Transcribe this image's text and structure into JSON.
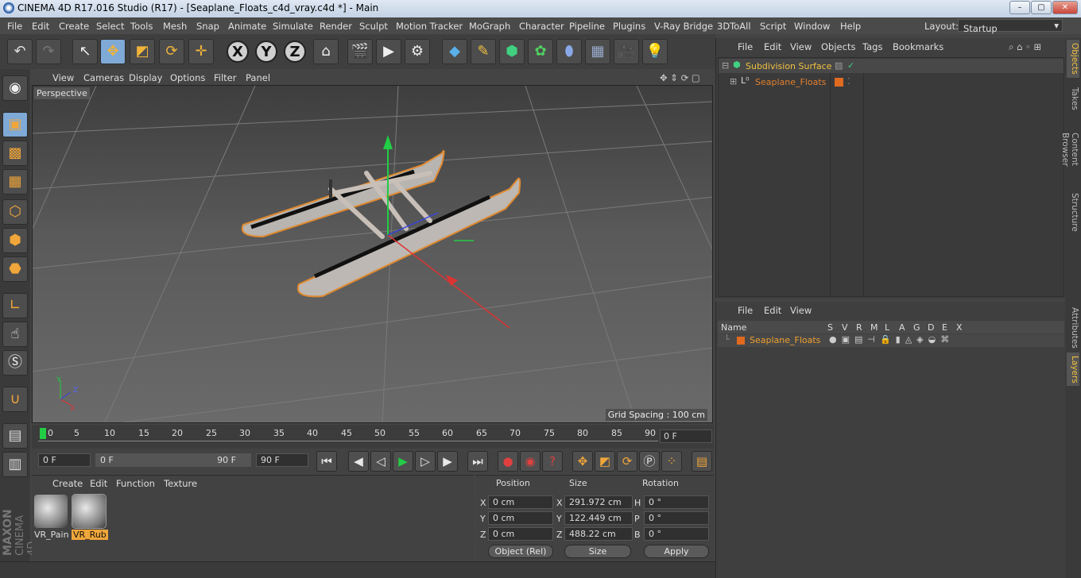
{
  "window": {
    "title": "CINEMA 4D R17.016 Studio (R17) - [Seaplane_Floats_c4d_vray.c4d *] - Main",
    "controls": [
      "–",
      "▢",
      "✕"
    ]
  },
  "menu": {
    "items": [
      "File",
      "Edit",
      "Create",
      "Select",
      "Tools",
      "Mesh",
      "Snap",
      "Animate",
      "Simulate",
      "Render",
      "Sculpt",
      "Motion Tracker",
      "MoGraph",
      "Character",
      "Pipeline",
      "Plugins",
      "V-Ray Bridge",
      "3DToAll",
      "Script",
      "Window",
      "Help"
    ],
    "layout_label": "Layout:",
    "layout_value": "Startup"
  },
  "toolbar": {
    "xyz": [
      "X",
      "Y",
      "Z"
    ]
  },
  "viewport": {
    "menu": [
      "View",
      "Cameras",
      "Display",
      "Options",
      "Filter",
      "Panel"
    ],
    "camera_label": "Perspective",
    "grid_spacing": "Grid Spacing : 100 cm",
    "axis_labels": [
      "Y",
      "Z",
      "X"
    ]
  },
  "timeline": {
    "ticks": [
      "0",
      "5",
      "10",
      "15",
      "20",
      "25",
      "30",
      "35",
      "40",
      "45",
      "50",
      "55",
      "60",
      "65",
      "70",
      "75",
      "80",
      "85",
      "90"
    ],
    "current_frame": "0 F"
  },
  "transport": {
    "start": "0 F",
    "range_start": "0 F",
    "range_end": "90 F",
    "end": "90 F"
  },
  "materials": {
    "menu": [
      "Create",
      "Edit",
      "Function",
      "Texture"
    ],
    "items": [
      {
        "name": "VR_Pain",
        "selected": false
      },
      {
        "name": "VR_Rub",
        "selected": true
      }
    ]
  },
  "coordinates": {
    "headers": [
      "Position",
      "Size",
      "Rotation"
    ],
    "rows": [
      {
        "axis": "X",
        "pos": "0 cm",
        "size_axis": "X",
        "size": "291.972 cm",
        "rot_axis": "H",
        "rot": "0 °"
      },
      {
        "axis": "Y",
        "pos": "0 cm",
        "size_axis": "Y",
        "size": "122.449 cm",
        "rot_axis": "P",
        "rot": "0 °"
      },
      {
        "axis": "Z",
        "pos": "0 cm",
        "size_axis": "Z",
        "size": "488.22 cm",
        "rot_axis": "B",
        "rot": "0 °"
      }
    ],
    "mode": "Object (Rel)",
    "size_mode": "Size",
    "apply": "Apply"
  },
  "object_manager": {
    "menu": [
      "File",
      "Edit",
      "View",
      "Objects",
      "Tags",
      "Bookmarks"
    ],
    "objects": [
      {
        "name": "Subdivision Surface",
        "color": "#f0c040"
      },
      {
        "name": "Seaplane_Floats",
        "color": "#e08030"
      }
    ]
  },
  "layer_manager": {
    "menu": [
      "File",
      "Edit",
      "View"
    ],
    "columns": [
      "Name",
      "S",
      "V",
      "R",
      "M",
      "L",
      "A",
      "G",
      "D",
      "E",
      "X"
    ],
    "layers": [
      {
        "name": "Seaplane_Floats",
        "color": "#e08030"
      }
    ]
  },
  "right_tabs": [
    "Objects",
    "Takes",
    "Content Browser",
    "Structure",
    "Attributes",
    "Layers"
  ],
  "branding": {
    "maxon": "MAXON",
    "product": "CINEMA 4D"
  }
}
